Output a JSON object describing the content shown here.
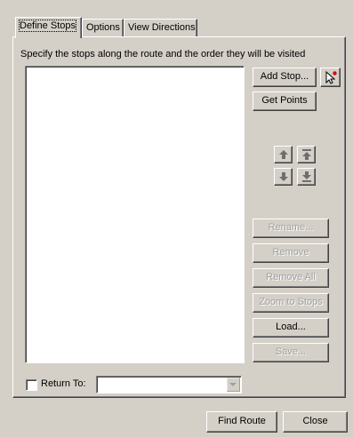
{
  "tabs": [
    {
      "label": "Define Stops",
      "active": true
    },
    {
      "label": "Options",
      "active": false
    },
    {
      "label": "View Directions",
      "active": false
    }
  ],
  "instruction": "Specify the stops along the route and the order they will be visited",
  "stops_list": [],
  "buttons": {
    "add_stop": "Add Stop...",
    "get_points": "Get Points",
    "rename": "Rename...",
    "remove": "Remove",
    "remove_all": "Remove All",
    "zoom_to_stops": "Zoom to Stops",
    "load": "Load...",
    "save": "Save...",
    "find_route": "Find Route",
    "close": "Close"
  },
  "icons": {
    "add_point_tool": "pointer-with-red-dot-icon",
    "move_up": "arrow-up-icon",
    "move_to_top": "arrow-to-top-icon",
    "move_down": "arrow-down-icon",
    "move_to_bottom": "arrow-to-bottom-icon"
  },
  "return_to": {
    "label": "Return To:",
    "checked": false,
    "selected_value": ""
  },
  "colors": {
    "face": "#d4d0c8",
    "disabled_text": "#a0a0a0",
    "arrow_active": "#6e6e6e",
    "red_dot": "#e00000"
  }
}
